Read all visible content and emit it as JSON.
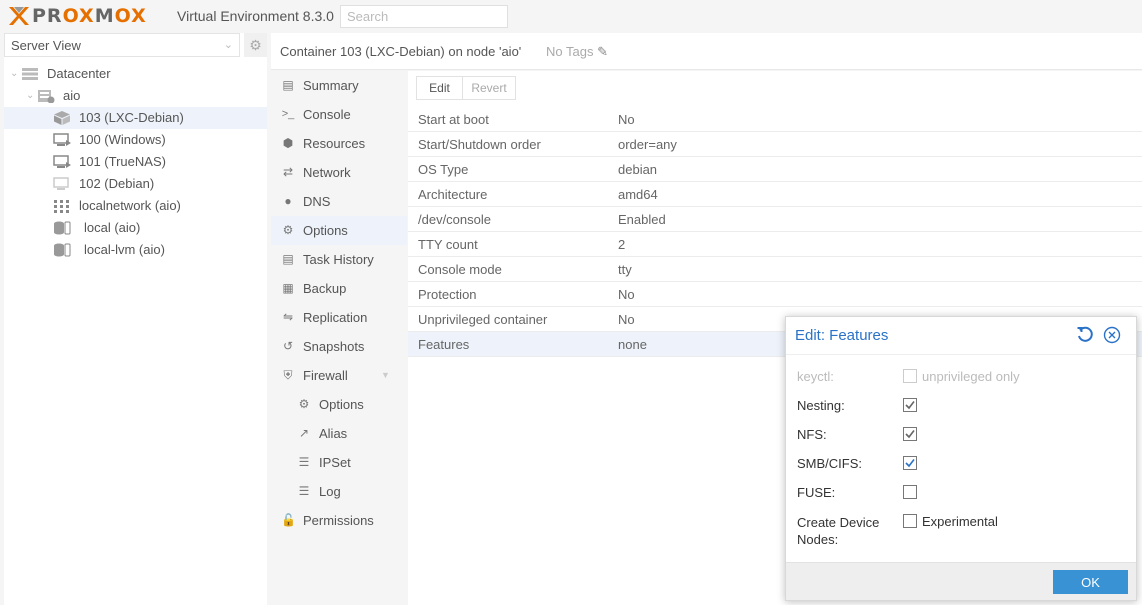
{
  "header": {
    "logo_prefix": "PR",
    "logo_ox1": "OX",
    "logo_middle": "M",
    "logo_ox2": "OX",
    "version": "Virtual Environment 8.3.0",
    "search_placeholder": "Search"
  },
  "tree": {
    "view": "Server View",
    "nodes": [
      {
        "label": "Datacenter",
        "icon": "datacenter-icon"
      },
      {
        "label": "aio",
        "icon": "node-icon"
      },
      {
        "label": "103 (LXC-Debian)",
        "icon": "container-icon"
      },
      {
        "label": "100 (Windows)",
        "icon": "vm-icon"
      },
      {
        "label": "101 (TrueNAS)",
        "icon": "vm-icon"
      },
      {
        "label": "102 (Debian)",
        "icon": "vm-stopped-icon"
      },
      {
        "label": "localnetwork (aio)",
        "icon": "network-icon"
      },
      {
        "label": "local (aio)",
        "icon": "storage-icon"
      },
      {
        "label": "local-lvm (aio)",
        "icon": "storage-icon"
      }
    ]
  },
  "content": {
    "title": "Container 103 (LXC-Debian) on node 'aio'",
    "tags": "No Tags"
  },
  "submenu": [
    {
      "label": "Summary",
      "icon": "summary-icon"
    },
    {
      "label": "Console",
      "icon": "console-icon"
    },
    {
      "label": "Resources",
      "icon": "resources-icon"
    },
    {
      "label": "Network",
      "icon": "network-icon"
    },
    {
      "label": "DNS",
      "icon": "dns-icon"
    },
    {
      "label": "Options",
      "icon": "gear-icon"
    },
    {
      "label": "Task History",
      "icon": "task-history-icon"
    },
    {
      "label": "Backup",
      "icon": "backup-icon"
    },
    {
      "label": "Replication",
      "icon": "replication-icon"
    },
    {
      "label": "Snapshots",
      "icon": "snapshots-icon"
    },
    {
      "label": "Firewall",
      "icon": "shield-icon"
    },
    {
      "label": "Options",
      "icon": "gear-icon"
    },
    {
      "label": "Alias",
      "icon": "alias-icon"
    },
    {
      "label": "IPSet",
      "icon": "list-icon"
    },
    {
      "label": "Log",
      "icon": "log-icon"
    },
    {
      "label": "Permissions",
      "icon": "unlock-icon"
    }
  ],
  "toolbar": {
    "edit": "Edit",
    "revert": "Revert"
  },
  "options": [
    {
      "key": "Start at boot",
      "value": "No"
    },
    {
      "key": "Start/Shutdown order",
      "value": "order=any"
    },
    {
      "key": "OS Type",
      "value": "debian"
    },
    {
      "key": "Architecture",
      "value": "amd64"
    },
    {
      "key": "/dev/console",
      "value": "Enabled"
    },
    {
      "key": "TTY count",
      "value": "2"
    },
    {
      "key": "Console mode",
      "value": "tty"
    },
    {
      "key": "Protection",
      "value": "No"
    },
    {
      "key": "Unprivileged container",
      "value": "No"
    },
    {
      "key": "Features",
      "value": "none"
    }
  ],
  "dialog": {
    "title": "Edit: Features",
    "fields": [
      {
        "label": "keyctl:",
        "checked": false,
        "disabled": true,
        "extra": "unprivileged only"
      },
      {
        "label": "Nesting:",
        "checked": true,
        "disabled": false,
        "extra": ""
      },
      {
        "label": "NFS:",
        "checked": true,
        "disabled": false,
        "extra": ""
      },
      {
        "label": "SMB/CIFS:",
        "checked": true,
        "disabled": false,
        "extra": ""
      },
      {
        "label": "FUSE:",
        "checked": false,
        "disabled": false,
        "extra": ""
      },
      {
        "label": "Create Device Nodes:",
        "checked": false,
        "disabled": false,
        "extra": "Experimental"
      }
    ],
    "ok": "OK"
  },
  "colors": {
    "accent": "#2a72c8",
    "ok_button": "#3892d4",
    "logo_orange": "#e57000",
    "selection": "#eef3fb"
  }
}
